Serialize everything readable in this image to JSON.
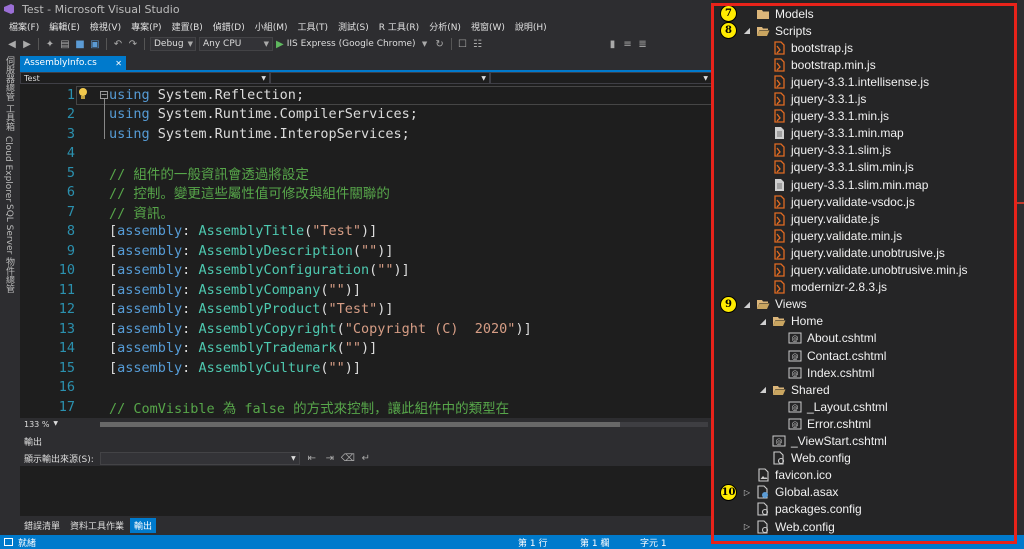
{
  "window": {
    "title": "Test - Microsoft Visual Studio"
  },
  "menu": [
    "檔案(F)",
    "編輯(E)",
    "檢視(V)",
    "專案(P)",
    "建置(B)",
    "偵錯(D)",
    "小組(M)",
    "工具(T)",
    "測試(S)",
    "R 工具(R)",
    "分析(N)",
    "視窗(W)",
    "說明(H)"
  ],
  "toolbar": {
    "config": "Debug",
    "platform": "Any CPU",
    "run_target": "IIS Express (Google Chrome)"
  },
  "left_rail": [
    "伺服器總管",
    "工具箱",
    "Cloud Explorer",
    "SQL Server 物件總管"
  ],
  "editor": {
    "tab": "AssemblyInfo.cs",
    "nav_project": "Test",
    "zoom": "133 %",
    "lines": [
      {
        "n": "1",
        "tokens": [
          [
            "kw",
            "using"
          ],
          [
            "pl",
            " System.Reflection;"
          ]
        ]
      },
      {
        "n": "2",
        "tokens": [
          [
            "kw",
            "using"
          ],
          [
            "pl",
            " System.Runtime.CompilerServices;"
          ]
        ]
      },
      {
        "n": "3",
        "tokens": [
          [
            "kw",
            "using"
          ],
          [
            "pl",
            " System.Runtime.InteropServices;"
          ]
        ]
      },
      {
        "n": "4",
        "tokens": []
      },
      {
        "n": "5",
        "tokens": [
          [
            "cm",
            "// 組件的一般資訊會透過將設定"
          ]
        ]
      },
      {
        "n": "6",
        "tokens": [
          [
            "cm",
            "// 控制。變更這些屬性值可修改與組件關聯的"
          ]
        ]
      },
      {
        "n": "7",
        "tokens": [
          [
            "cm",
            "// 資訊。"
          ]
        ]
      },
      {
        "n": "8",
        "tokens": [
          [
            "pl",
            "["
          ],
          [
            "kw",
            "assembly"
          ],
          [
            "pl",
            ": "
          ],
          [
            "ty",
            "AssemblyTitle"
          ],
          [
            "pl",
            "("
          ],
          [
            "st",
            "\"Test\""
          ],
          [
            "pl",
            ")]"
          ]
        ]
      },
      {
        "n": "9",
        "tokens": [
          [
            "pl",
            "["
          ],
          [
            "kw",
            "assembly"
          ],
          [
            "pl",
            ": "
          ],
          [
            "ty",
            "AssemblyDescription"
          ],
          [
            "pl",
            "("
          ],
          [
            "st",
            "\"\""
          ],
          [
            "pl",
            ")]"
          ]
        ]
      },
      {
        "n": "10",
        "tokens": [
          [
            "pl",
            "["
          ],
          [
            "kw",
            "assembly"
          ],
          [
            "pl",
            ": "
          ],
          [
            "ty",
            "AssemblyConfiguration"
          ],
          [
            "pl",
            "("
          ],
          [
            "st",
            "\"\""
          ],
          [
            "pl",
            ")]"
          ]
        ]
      },
      {
        "n": "11",
        "tokens": [
          [
            "pl",
            "["
          ],
          [
            "kw",
            "assembly"
          ],
          [
            "pl",
            ": "
          ],
          [
            "ty",
            "AssemblyCompany"
          ],
          [
            "pl",
            "("
          ],
          [
            "st",
            "\"\""
          ],
          [
            "pl",
            ")]"
          ]
        ]
      },
      {
        "n": "12",
        "tokens": [
          [
            "pl",
            "["
          ],
          [
            "kw",
            "assembly"
          ],
          [
            "pl",
            ": "
          ],
          [
            "ty",
            "AssemblyProduct"
          ],
          [
            "pl",
            "("
          ],
          [
            "st",
            "\"Test\""
          ],
          [
            "pl",
            ")]"
          ]
        ]
      },
      {
        "n": "13",
        "tokens": [
          [
            "pl",
            "["
          ],
          [
            "kw",
            "assembly"
          ],
          [
            "pl",
            ": "
          ],
          [
            "ty",
            "AssemblyCopyright"
          ],
          [
            "pl",
            "("
          ],
          [
            "st",
            "\"Copyright (C)  2020\""
          ],
          [
            "pl",
            ")]"
          ]
        ]
      },
      {
        "n": "14",
        "tokens": [
          [
            "pl",
            "["
          ],
          [
            "kw",
            "assembly"
          ],
          [
            "pl",
            ": "
          ],
          [
            "ty",
            "AssemblyTrademark"
          ],
          [
            "pl",
            "("
          ],
          [
            "st",
            "\"\""
          ],
          [
            "pl",
            ")]"
          ]
        ]
      },
      {
        "n": "15",
        "tokens": [
          [
            "pl",
            "["
          ],
          [
            "kw",
            "assembly"
          ],
          [
            "pl",
            ": "
          ],
          [
            "ty",
            "AssemblyCulture"
          ],
          [
            "pl",
            "("
          ],
          [
            "st",
            "\"\""
          ],
          [
            "pl",
            ")]"
          ]
        ]
      },
      {
        "n": "16",
        "tokens": []
      },
      {
        "n": "17",
        "tokens": [
          [
            "cm",
            "// ComVisible 為 false 的方式來控制，讓此組件中的類型在"
          ]
        ]
      }
    ]
  },
  "output": {
    "title": "輸出",
    "source_label": "顯示輸出來源(S):",
    "tabs": [
      "錯誤清單",
      "資料工具作業",
      "輸出"
    ]
  },
  "statusbar": {
    "ready": "就緒",
    "line": "第 1 行",
    "col": "第 1 欄",
    "ch": "字元 1"
  },
  "solution_tree": [
    {
      "label": "Models",
      "icon": "folder-icon",
      "depth": 1,
      "expander": "",
      "badge": "7"
    },
    {
      "label": "Scripts",
      "icon": "folder-open-icon",
      "depth": 1,
      "expander": "◢",
      "badge": "8"
    },
    {
      "label": "bootstrap.js",
      "icon": "js-file-icon",
      "depth": 2
    },
    {
      "label": "bootstrap.min.js",
      "icon": "js-file-icon",
      "depth": 2
    },
    {
      "label": "jquery-3.3.1.intellisense.js",
      "icon": "js-file-icon",
      "depth": 2
    },
    {
      "label": "jquery-3.3.1.js",
      "icon": "js-file-icon",
      "depth": 2
    },
    {
      "label": "jquery-3.3.1.min.js",
      "icon": "js-file-icon",
      "depth": 2
    },
    {
      "label": "jquery-3.3.1.min.map",
      "icon": "text-file-icon",
      "depth": 2
    },
    {
      "label": "jquery-3.3.1.slim.js",
      "icon": "js-file-icon",
      "depth": 2
    },
    {
      "label": "jquery-3.3.1.slim.min.js",
      "icon": "js-file-icon",
      "depth": 2
    },
    {
      "label": "jquery-3.3.1.slim.min.map",
      "icon": "text-file-icon",
      "depth": 2
    },
    {
      "label": "jquery.validate-vsdoc.js",
      "icon": "js-file-icon",
      "depth": 2
    },
    {
      "label": "jquery.validate.js",
      "icon": "js-file-icon",
      "depth": 2
    },
    {
      "label": "jquery.validate.min.js",
      "icon": "js-file-icon",
      "depth": 2
    },
    {
      "label": "jquery.validate.unobtrusive.js",
      "icon": "js-file-icon",
      "depth": 2
    },
    {
      "label": "jquery.validate.unobtrusive.min.js",
      "icon": "js-file-icon",
      "depth": 2
    },
    {
      "label": "modernizr-2.8.3.js",
      "icon": "js-file-icon",
      "depth": 2
    },
    {
      "label": "Views",
      "icon": "folder-open-icon",
      "depth": 1,
      "expander": "◢",
      "badge": "9"
    },
    {
      "label": "Home",
      "icon": "folder-open-icon",
      "depth": 2,
      "expander": "◢"
    },
    {
      "label": "About.cshtml",
      "icon": "cshtml-file-icon",
      "depth": 3
    },
    {
      "label": "Contact.cshtml",
      "icon": "cshtml-file-icon",
      "depth": 3
    },
    {
      "label": "Index.cshtml",
      "icon": "cshtml-file-icon",
      "depth": 3
    },
    {
      "label": "Shared",
      "icon": "folder-open-icon",
      "depth": 2,
      "expander": "◢"
    },
    {
      "label": "_Layout.cshtml",
      "icon": "cshtml-file-icon",
      "depth": 3
    },
    {
      "label": "Error.cshtml",
      "icon": "cshtml-file-icon",
      "depth": 3
    },
    {
      "label": "_ViewStart.cshtml",
      "icon": "cshtml-file-icon",
      "depth": 2
    },
    {
      "label": "Web.config",
      "icon": "config-file-icon",
      "depth": 2
    },
    {
      "label": "favicon.ico",
      "icon": "image-file-icon",
      "depth": 1
    },
    {
      "label": "Global.asax",
      "icon": "asax-file-icon",
      "depth": 1,
      "expander": "▷",
      "badge": "10"
    },
    {
      "label": "packages.config",
      "icon": "config-file-icon",
      "depth": 1
    },
    {
      "label": "Web.config",
      "icon": "config-file-icon",
      "depth": 1,
      "expander": "▷"
    }
  ],
  "colors": {
    "accent": "#007acc",
    "highlight_outline": "#e8231a",
    "badge": "#ffeb00",
    "js_icon": "#e06b22"
  }
}
